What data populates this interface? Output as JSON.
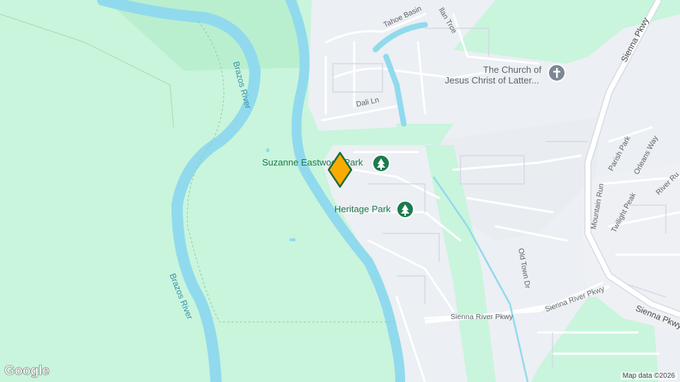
{
  "map": {
    "rivers": [
      {
        "name": "Brazos River"
      },
      {
        "name": "Brazos River"
      }
    ],
    "streets": [
      "Tahoe Basin",
      "llan Trce",
      "Dali Ln",
      "Sienna Pkwy",
      "Sienna Pkwy",
      "Sienna River Pkwy",
      "Sienna River Pkwy",
      "Old Town Dr",
      "Mountain Run",
      "Twilight Peak",
      "Parish Park",
      "Orleans Way",
      "River Ru"
    ],
    "parks": [
      {
        "name": "Suzanne Eastwood Park",
        "icon": "tree-icon"
      },
      {
        "name": "Heritage Park",
        "icon": "tree-icon"
      }
    ],
    "poi": {
      "name": "The Church of Jesus Christ of Latter...",
      "line1": "The Church of",
      "line2": "Jesus Christ of Latter...",
      "icon": "cross-icon"
    },
    "marker": {
      "icon": "diamond-marker-icon",
      "color": "#f9ab00"
    },
    "attribution": "Map data ©2026",
    "logo": "Google",
    "colors": {
      "land": "#c8f5dc",
      "water": "#91daee",
      "urban": "#eceff3",
      "road": "#ffffff"
    }
  }
}
